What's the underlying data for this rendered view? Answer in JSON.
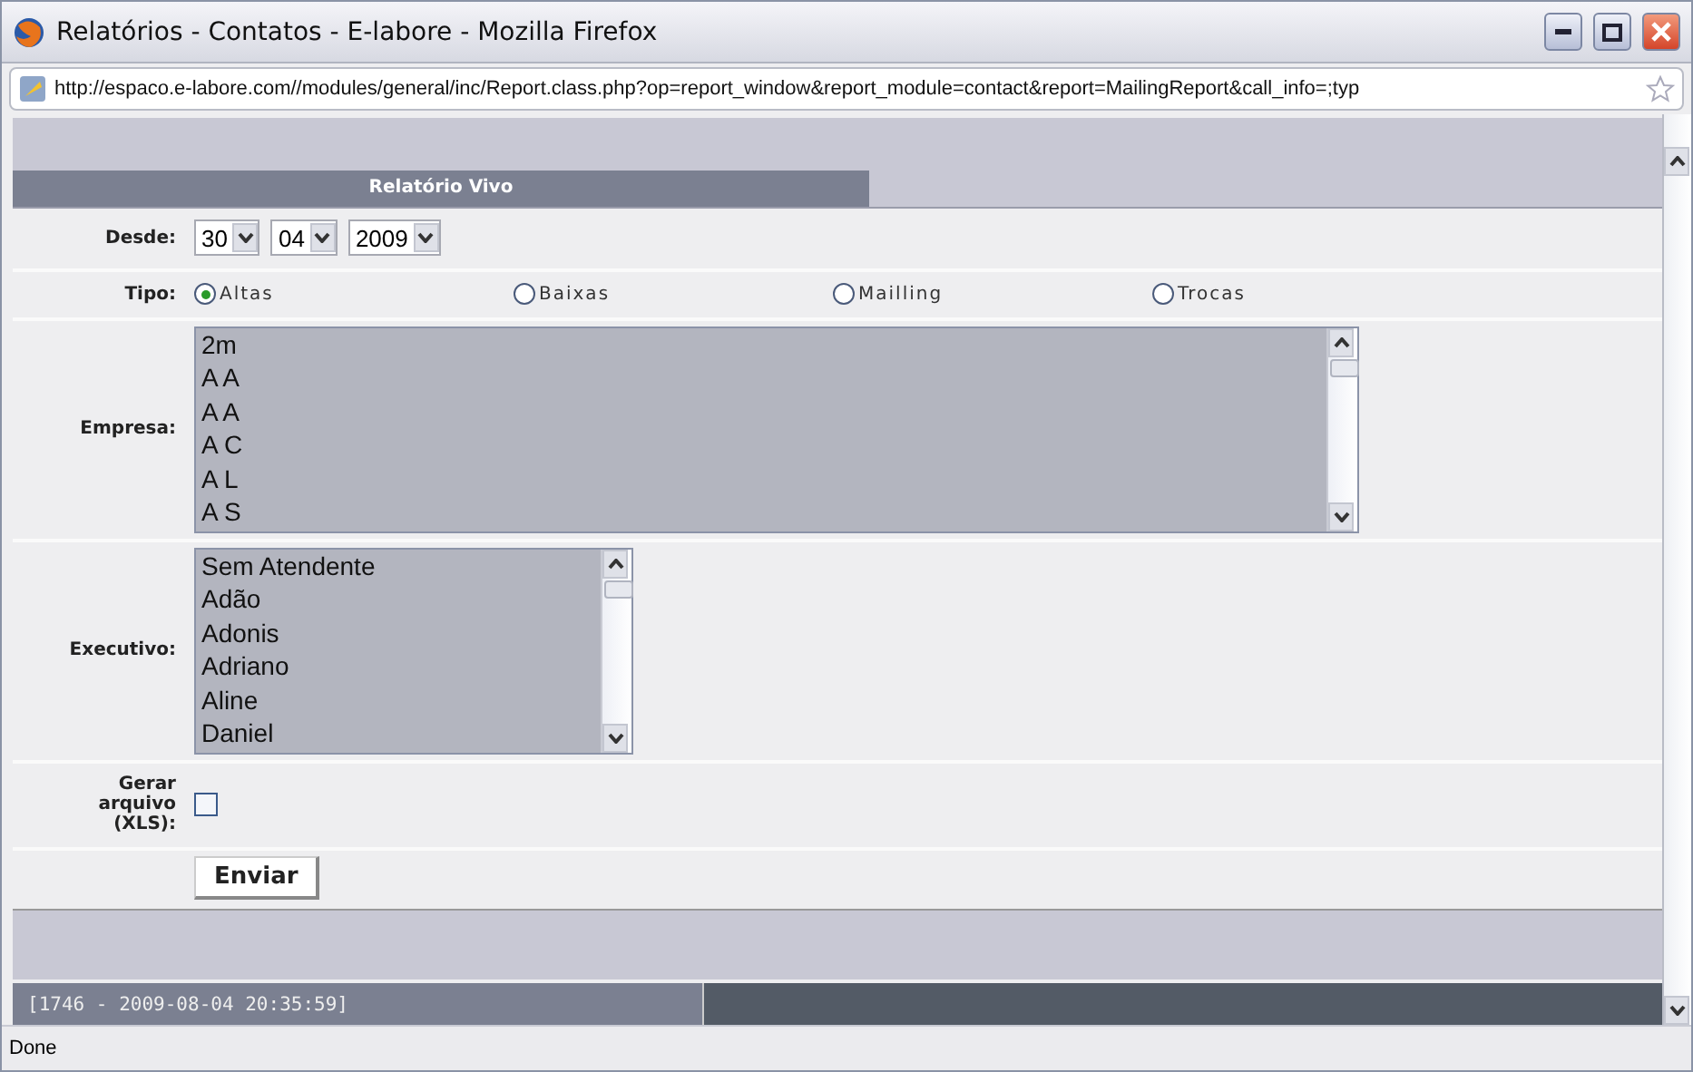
{
  "window": {
    "title": "Relatórios - Contatos - E-labore - Mozilla Firefox"
  },
  "address_bar": {
    "url": "http://espaco.e-labore.com//modules/general/inc/Report.class.php?op=report_window&report_module=contact&report=MailingReport&call_info=;typ"
  },
  "panel": {
    "title": "Relatório Vivo"
  },
  "desde": {
    "label": "Desde:",
    "day": "30",
    "month": "04",
    "year": "2009"
  },
  "tipo": {
    "label": "Tipo:",
    "options": [
      {
        "label": "Altas",
        "selected": true
      },
      {
        "label": "Baixas",
        "selected": false
      },
      {
        "label": "Mailling",
        "selected": false
      },
      {
        "label": "Trocas",
        "selected": false
      }
    ]
  },
  "empresa": {
    "label": "Empresa:",
    "items": [
      "2m",
      "A A",
      "A A",
      "A C",
      "A L",
      "A S"
    ]
  },
  "executivo": {
    "label": "Executivo:",
    "items": [
      "Sem Atendente",
      "Adão",
      "Adonis",
      "Adriano",
      "Aline",
      "Daniel"
    ]
  },
  "gerar": {
    "label": "Gerar arquivo (XLS):",
    "checked": false
  },
  "submit": {
    "label": "Enviar"
  },
  "footer": {
    "text": "[1746 - 2009-08-04 20:35:59]"
  },
  "status_bar": {
    "text": "Done"
  }
}
